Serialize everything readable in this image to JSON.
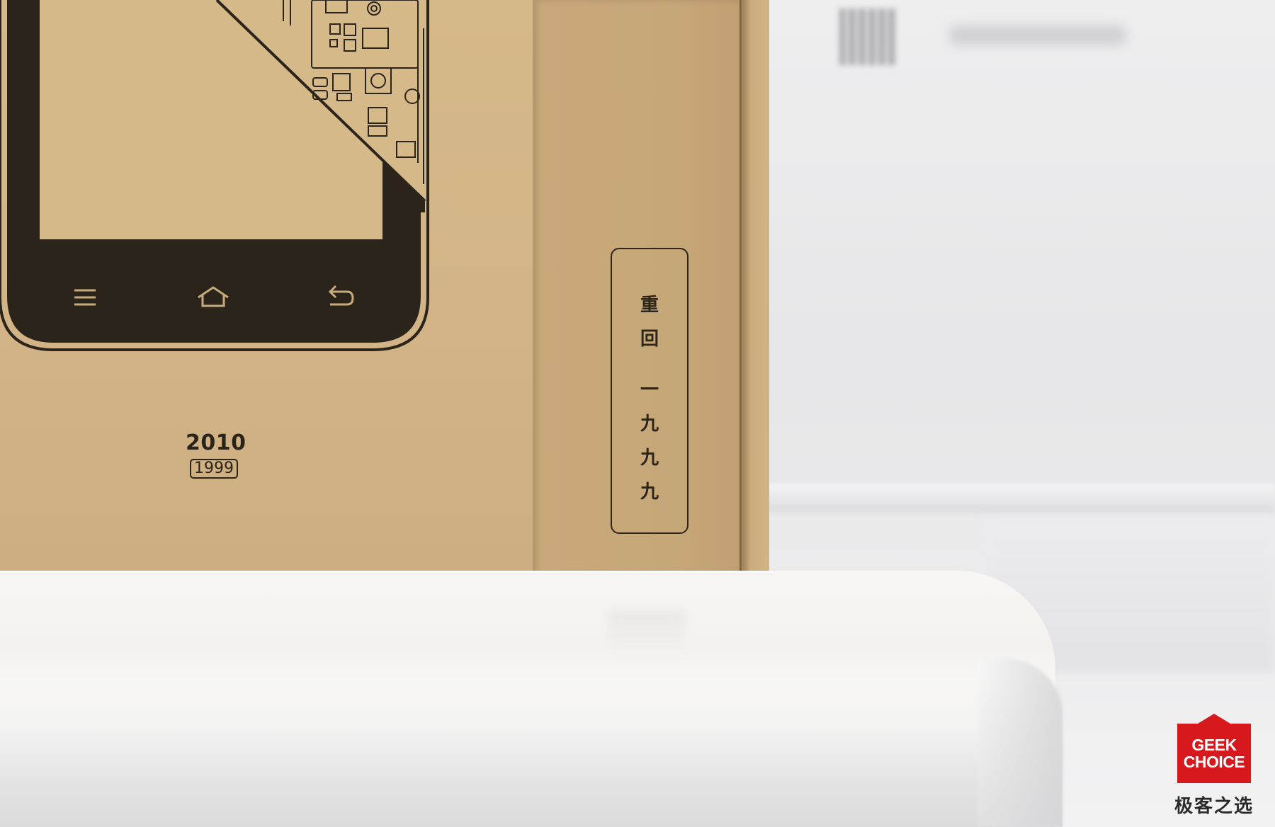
{
  "box": {
    "front_year": "2010",
    "front_year_boxed": "1999",
    "side_label_chars": [
      "重",
      "回",
      "一",
      "九",
      "九",
      "九"
    ]
  },
  "phone_nav_icons": [
    "menu-icon",
    "home-icon",
    "back-icon"
  ],
  "watermark": {
    "line1": "GEEK",
    "line2": "CHOICE",
    "chinese": "极客之选",
    "color": "#d7191d"
  },
  "colors": {
    "kraft": "#d4b788",
    "ink": "#2a241b"
  }
}
